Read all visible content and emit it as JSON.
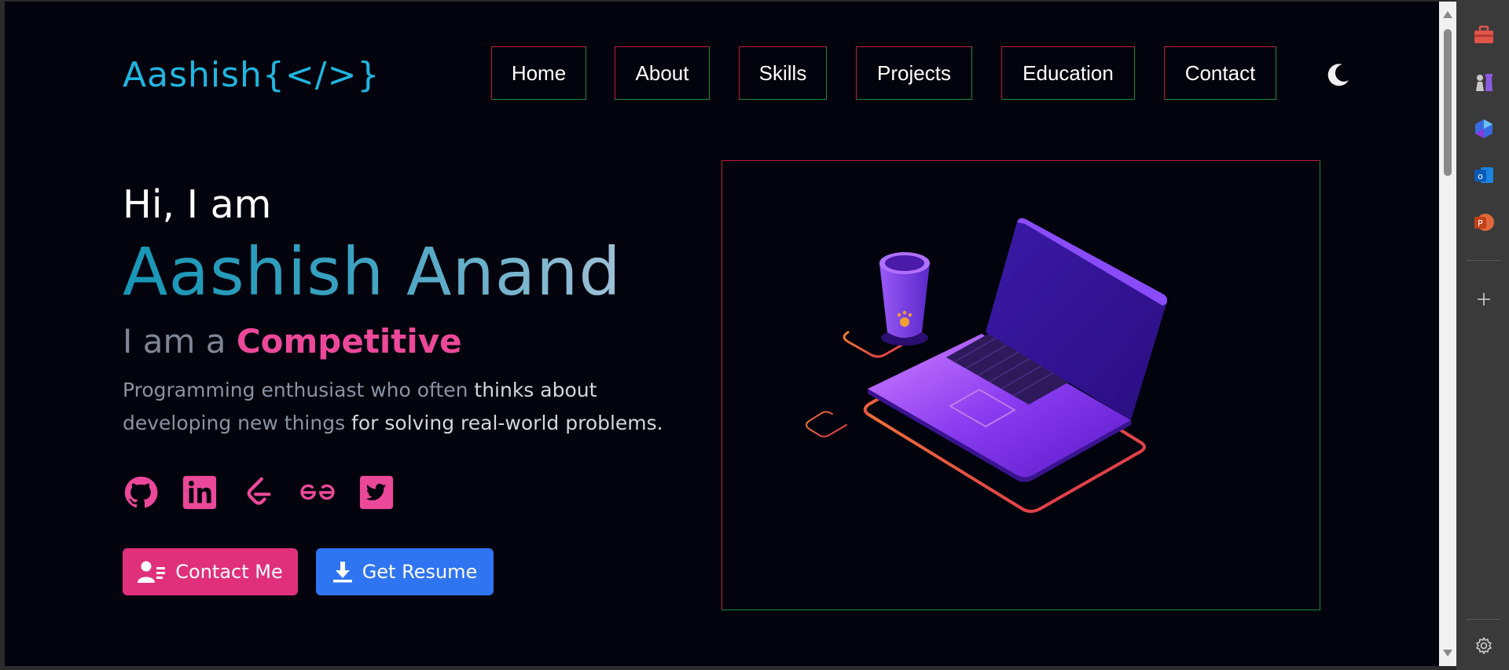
{
  "logo": {
    "text": "Aashish{</>}"
  },
  "nav": {
    "items": [
      {
        "label": "Home"
      },
      {
        "label": "About"
      },
      {
        "label": "Skills"
      },
      {
        "label": "Projects"
      },
      {
        "label": "Education"
      },
      {
        "label": "Contact"
      }
    ],
    "theme_toggle_icon": "moon-icon"
  },
  "hero": {
    "greeting": "Hi, I am",
    "name": "Aashish Anand",
    "role_prefix": "I am a",
    "role": "Competitive",
    "desc_1a": "Programming enthusiast who often ",
    "desc_1b": "thinks about",
    "desc_2a": "developing new things ",
    "desc_2b": "for solving real-world problems.",
    "socials": [
      "github-icon",
      "linkedin-icon",
      "leetcode-icon",
      "geeksforgeeks-icon",
      "twitter-icon"
    ],
    "contact_button": "Contact Me",
    "resume_button": "Get Resume"
  },
  "colors": {
    "accent_pink": "#ec4899",
    "accent_blue": "#2f74f0",
    "logo_cyan": "#1fb6e0",
    "background": "#02030d"
  },
  "sidebar": {
    "icons": [
      "toolbox-icon",
      "chess-icon",
      "copilot-icon",
      "outlook-icon",
      "powerpoint-icon",
      "add-icon",
      "settings-icon"
    ]
  }
}
